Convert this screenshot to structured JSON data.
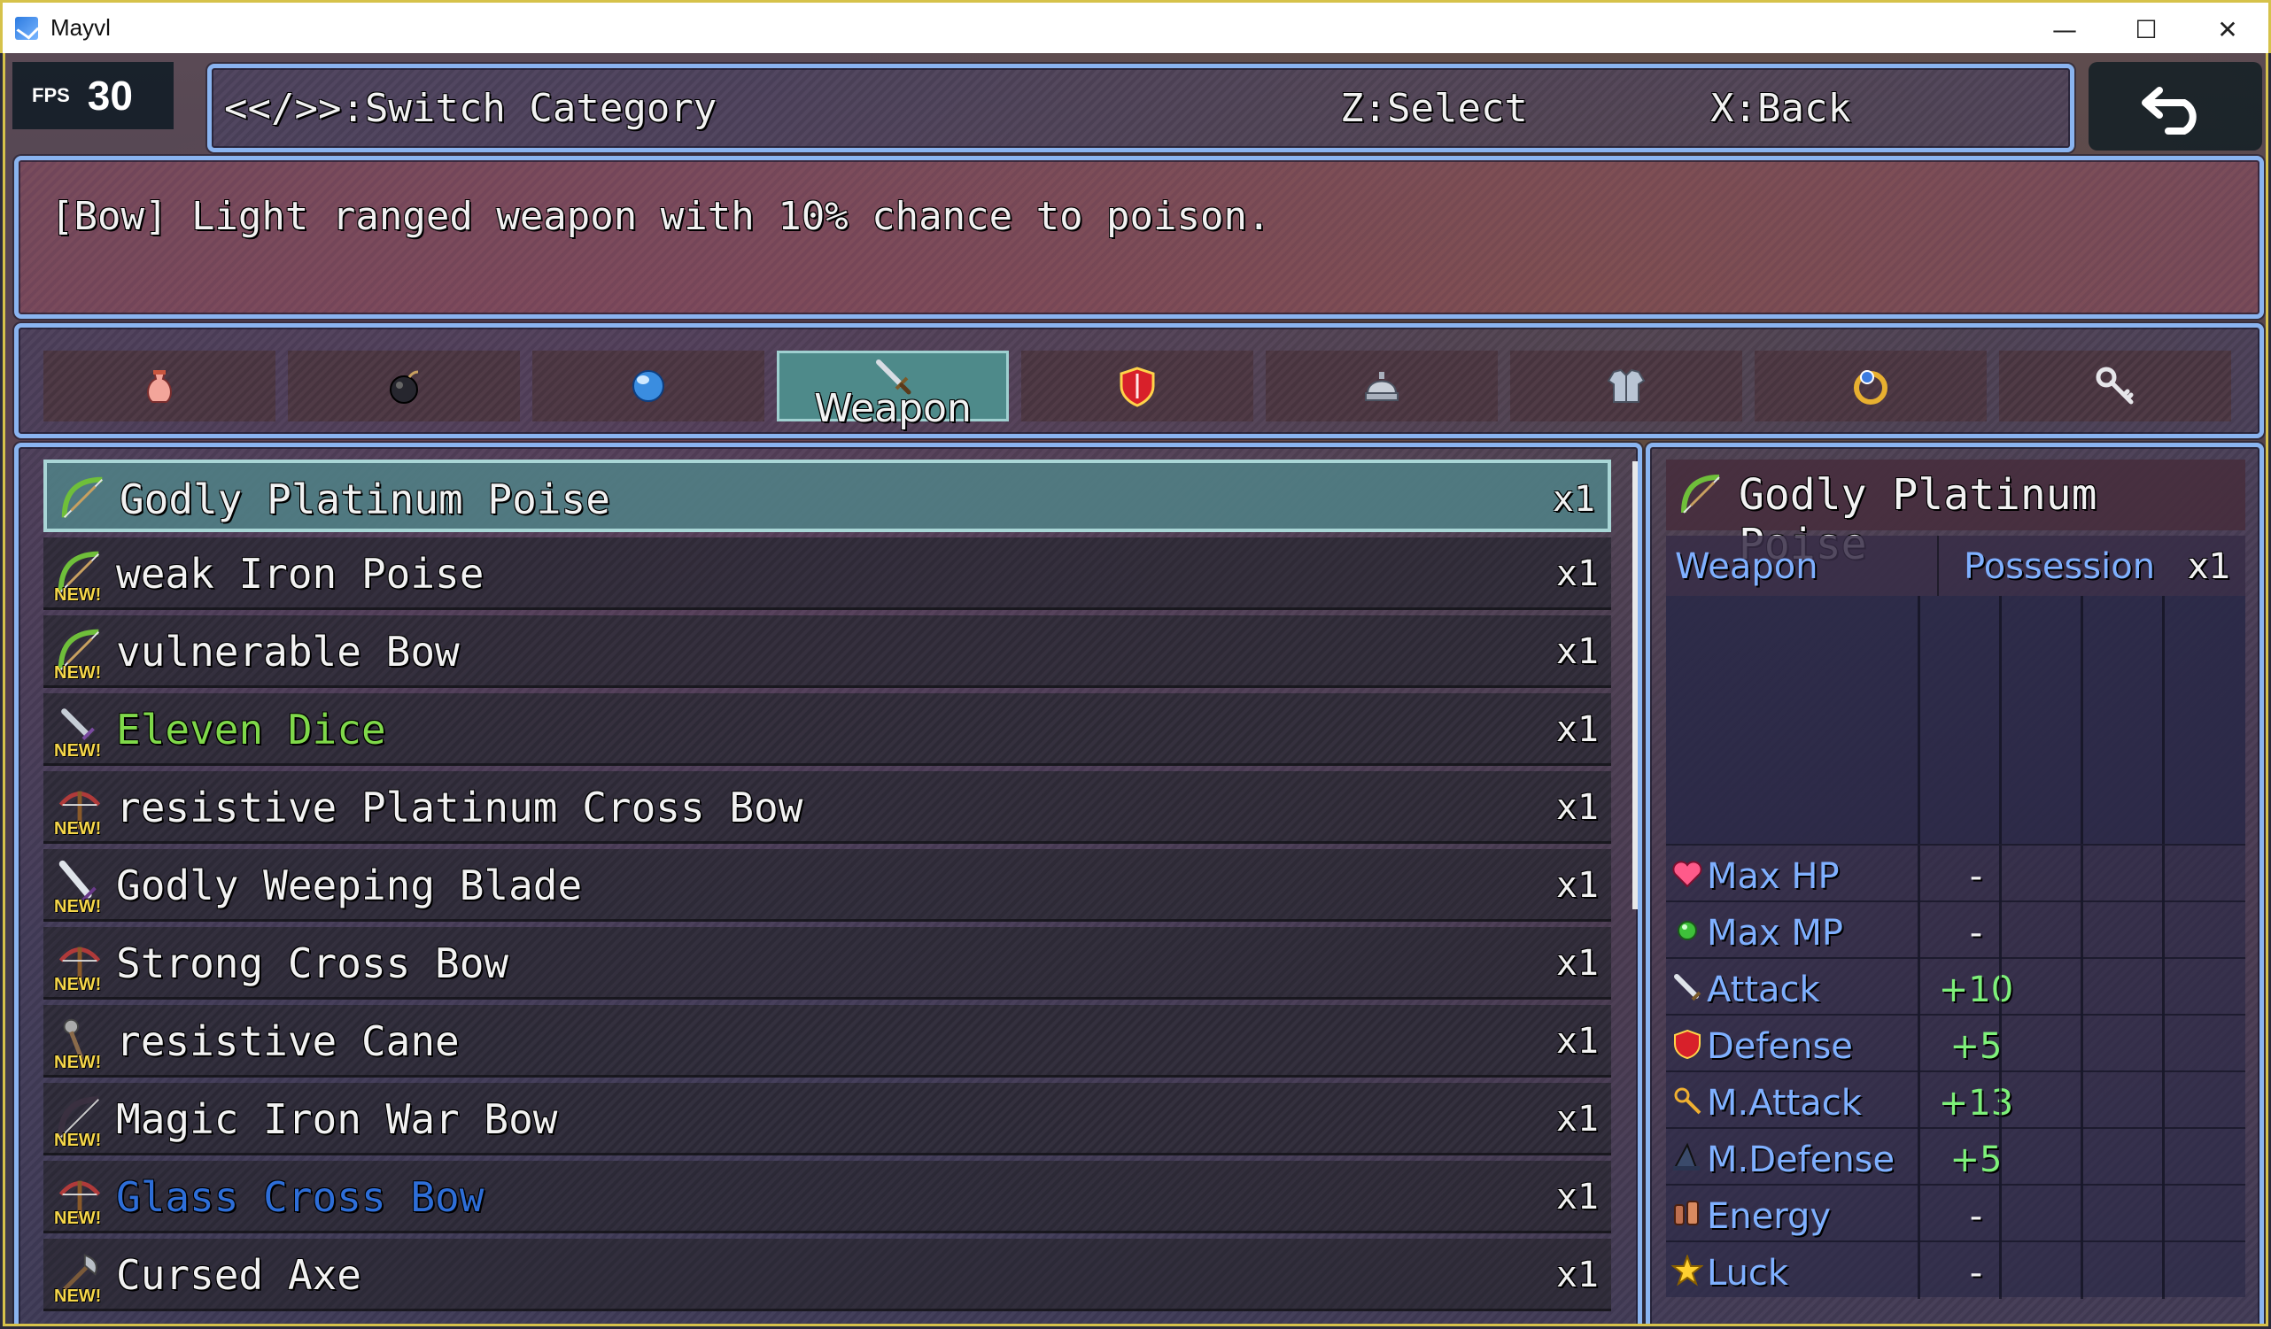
{
  "window": {
    "title": "Mayvl",
    "minimize": "—",
    "maximize": "☐",
    "close": "✕"
  },
  "fps": {
    "label": "FPS",
    "value": "30"
  },
  "help": {
    "switch": "<</>>:Switch Category",
    "select": "Z:Select",
    "back": "X:Back"
  },
  "description": "[Bow] Light ranged weapon with 10% chance to poison.",
  "categories": [
    {
      "name": "Items",
      "icon": "potion-bag-icon"
    },
    {
      "name": "Bombs",
      "icon": "bomb-icon"
    },
    {
      "name": "Orbs",
      "icon": "crystal-orb-icon"
    },
    {
      "name": "Weapon",
      "icon": "sword-icon",
      "label": "Weapon",
      "selected": true
    },
    {
      "name": "Shields",
      "icon": "shield-icon"
    },
    {
      "name": "Helmets",
      "icon": "helmet-icon"
    },
    {
      "name": "Armor",
      "icon": "armor-icon"
    },
    {
      "name": "Accessories",
      "icon": "ring-icon"
    },
    {
      "name": "Key Items",
      "icon": "key-icon"
    }
  ],
  "items": [
    {
      "name": "Godly Platinum Poise",
      "qty": "x1",
      "icon": "bow-icon",
      "new": false,
      "selected": true,
      "color": "#f2f2f2"
    },
    {
      "name": "weak Iron Poise",
      "qty": "x1",
      "icon": "bow-icon",
      "new": true,
      "color": "#f2f2f2"
    },
    {
      "name": "vulnerable Bow",
      "qty": "x1",
      "icon": "bow-icon",
      "new": true,
      "color": "#f2f2f2"
    },
    {
      "name": "Eleven Dice",
      "qty": "x1",
      "icon": "dagger-icon",
      "new": true,
      "color": "#7fd84a"
    },
    {
      "name": "resistive Platinum Cross Bow",
      "qty": "x1",
      "icon": "crossbow-icon",
      "new": true,
      "color": "#f2f2f2"
    },
    {
      "name": "Godly Weeping Blade",
      "qty": "x1",
      "icon": "blade-icon",
      "new": true,
      "color": "#f2f2f2"
    },
    {
      "name": "Strong Cross Bow",
      "qty": "x1",
      "icon": "crossbow-icon",
      "new": true,
      "color": "#f2f2f2"
    },
    {
      "name": "resistive Cane",
      "qty": "x1",
      "icon": "cane-icon",
      "new": true,
      "color": "#f2f2f2"
    },
    {
      "name": "Magic Iron War Bow",
      "qty": "x1",
      "icon": "warbow-icon",
      "new": true,
      "color": "#f2f2f2"
    },
    {
      "name": "Glass Cross Bow",
      "qty": "x1",
      "icon": "crossbow-icon",
      "new": true,
      "color": "#2e6ed8"
    },
    {
      "name": "Cursed Axe",
      "qty": "x1",
      "icon": "axe-icon",
      "new": true,
      "color": "#f2f2f2"
    }
  ],
  "new_badge": "NEW!",
  "detail": {
    "name": "Godly Platinum Poise",
    "category": "Weapon",
    "possession_label": "Possession",
    "possession_qty": "x1",
    "stats": [
      {
        "label": "Max HP",
        "value": "-",
        "icon": "heart-icon",
        "positive": false
      },
      {
        "label": "Max MP",
        "value": "-",
        "icon": "mp-orb-icon",
        "positive": false
      },
      {
        "label": "Attack",
        "value": "+10",
        "icon": "attack-icon",
        "positive": true
      },
      {
        "label": "Defense",
        "value": "+5",
        "icon": "defense-icon",
        "positive": true
      },
      {
        "label": "M.Attack",
        "value": "+13",
        "icon": "magic-wand-icon",
        "positive": true
      },
      {
        "label": "M.Defense",
        "value": "+5",
        "icon": "wizard-hat-icon",
        "positive": true
      },
      {
        "label": "Energy",
        "value": "-",
        "icon": "energy-icon",
        "positive": false
      },
      {
        "label": "Luck",
        "value": "-",
        "icon": "star-icon",
        "positive": false
      }
    ]
  }
}
